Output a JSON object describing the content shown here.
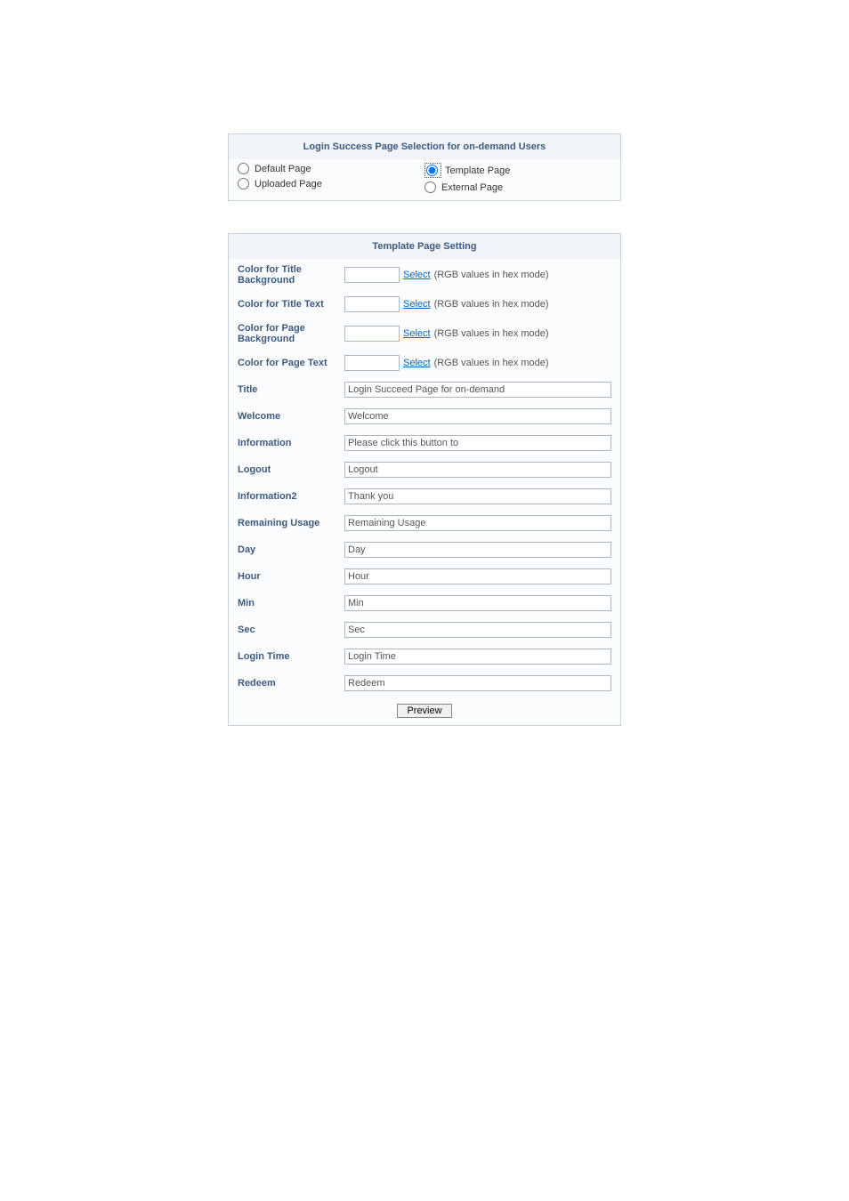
{
  "selectionPanel": {
    "title": "Login Success Page Selection for on-demand Users",
    "options": {
      "default": "Default Page",
      "template": "Template Page",
      "uploaded": "Uploaded Page",
      "external": "External Page"
    },
    "selected": "template"
  },
  "templatePanel": {
    "title": "Template Page Setting",
    "selectLinkText": "Select",
    "hexHint": "(RGB values in hex mode)",
    "previewButton": "Preview",
    "rows": {
      "colorTitleBg": {
        "label": "Color for Title Background"
      },
      "colorTitleText": {
        "label": "Color for Title Text"
      },
      "colorPageBg": {
        "label": "Color for Page Background"
      },
      "colorPageText": {
        "label": "Color for Page Text"
      },
      "title": {
        "label": "Title",
        "value": "Login Succeed Page for on-demand"
      },
      "welcome": {
        "label": "Welcome",
        "value": "Welcome"
      },
      "information": {
        "label": "Information",
        "value": "Please click this button to"
      },
      "logout": {
        "label": "Logout",
        "value": "Logout"
      },
      "information2": {
        "label": "Information2",
        "value": "Thank you"
      },
      "remainingUsage": {
        "label": "Remaining Usage",
        "value": "Remaining Usage"
      },
      "day": {
        "label": "Day",
        "value": "Day"
      },
      "hour": {
        "label": "Hour",
        "value": "Hour"
      },
      "min": {
        "label": "Min",
        "value": "Min"
      },
      "sec": {
        "label": "Sec",
        "value": "Sec"
      },
      "loginTime": {
        "label": "Login Time",
        "value": "Login Time"
      },
      "redeem": {
        "label": "Redeem",
        "value": "Redeem"
      }
    }
  }
}
